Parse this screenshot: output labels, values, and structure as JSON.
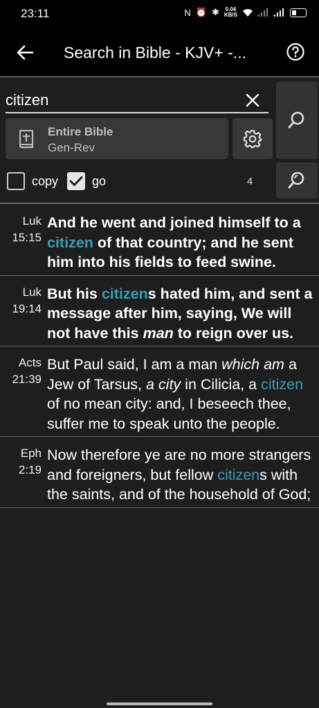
{
  "status": {
    "time": "23:11",
    "speed_value": "0.04",
    "speed_unit": "KB/S"
  },
  "app_bar": {
    "title": "Search in Bible - KJV+ -..."
  },
  "search": {
    "query": "citizen"
  },
  "scope": {
    "title": "Entire Bible",
    "range": "Gen-Rev"
  },
  "options": {
    "copy_label": "copy",
    "copy_checked": false,
    "go_label": "go",
    "go_checked": true,
    "result_count": "4"
  },
  "colors": {
    "highlight": "#35a0b6",
    "background": "#1e1e1e",
    "app_bar": "#000000"
  },
  "results": [
    {
      "book": "Luk",
      "ref": "15:15",
      "bold": true,
      "segments": [
        {
          "t": "And he went and joined himself to a "
        },
        {
          "t": "citizen",
          "h": true
        },
        {
          "t": " of that country; and he sent him into his fields to feed swine."
        }
      ]
    },
    {
      "book": "Luk",
      "ref": "19:14",
      "bold": true,
      "segments": [
        {
          "t": "But his "
        },
        {
          "t": "citizen",
          "h": true
        },
        {
          "t": "s hated him, and sent a message after him, saying, We will not have this "
        },
        {
          "t": "man",
          "i": true
        },
        {
          "t": " to reign over us."
        }
      ]
    },
    {
      "book": "Acts",
      "ref": "21:39",
      "bold": false,
      "segments": [
        {
          "t": "But Paul said, I am a man "
        },
        {
          "t": "which am",
          "i": true
        },
        {
          "t": " a Jew of Tarsus, "
        },
        {
          "t": "a city",
          "i": true
        },
        {
          "t": " in Cilicia, a "
        },
        {
          "t": "citizen",
          "h": true
        },
        {
          "t": " of no mean city: and, I beseech thee, suffer me to speak unto the people."
        }
      ]
    },
    {
      "book": "Eph",
      "ref": "2:19",
      "bold": false,
      "segments": [
        {
          "t": "Now therefore ye are no more strangers and foreigners, but fellow "
        },
        {
          "t": "citizen",
          "h": true
        },
        {
          "t": "s with the saints, and of the household of God;"
        }
      ]
    }
  ]
}
